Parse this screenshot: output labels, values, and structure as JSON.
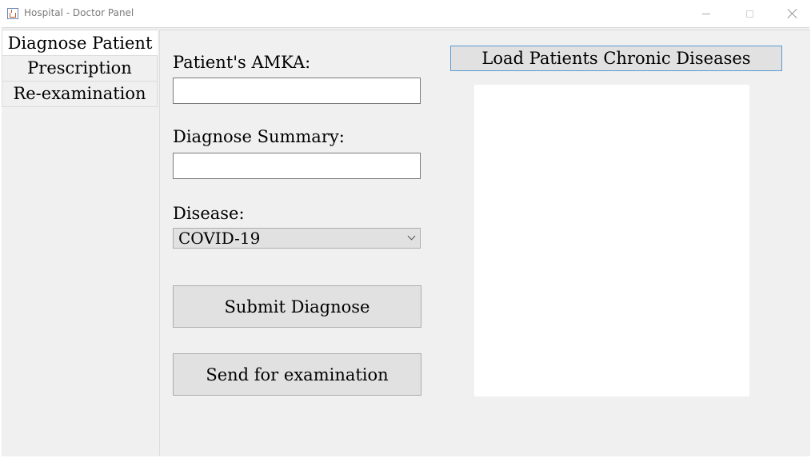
{
  "window": {
    "title": "Hospital - Doctor Panel",
    "icon": "java-cup-icon",
    "controls": [
      "minimize-icon",
      "maximize-icon",
      "close-icon"
    ]
  },
  "tabs": [
    {
      "label": "Diagnose Patient",
      "selected": true
    },
    {
      "label": "Prescription",
      "selected": false
    },
    {
      "label": "Re-examination",
      "selected": false
    }
  ],
  "form": {
    "amka_label": "Patient's AMKA:",
    "amka_value": "",
    "summary_label": "Diagnose Summary:",
    "summary_value": "",
    "disease_label": "Disease:",
    "disease_selected": "COVID-19",
    "submit_label": "Submit Diagnose",
    "send_label": "Send for examination"
  },
  "chronic": {
    "load_label": "Load Patients Chronic Diseases",
    "items": []
  },
  "colors": {
    "panel_bg": "#f0f0f0",
    "button_bg": "#e1e1e1",
    "focus_border": "#5b9bd5"
  }
}
